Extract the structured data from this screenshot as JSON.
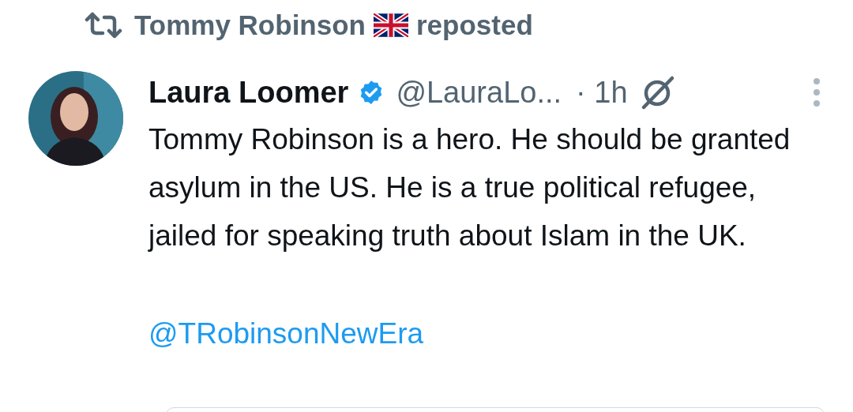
{
  "repost_banner": {
    "name": "Tommy Robinson",
    "action": "reposted"
  },
  "post": {
    "author": "Laura Loomer",
    "verified": true,
    "handle": "@LauraLo...",
    "time": "· 1h",
    "body": "Tommy Robinson is a hero. He should be granted asylum in the US. He is a true political refugee, jailed for speaking truth about Islam in the UK.",
    "mention": "@TRobinsonNewEra"
  }
}
